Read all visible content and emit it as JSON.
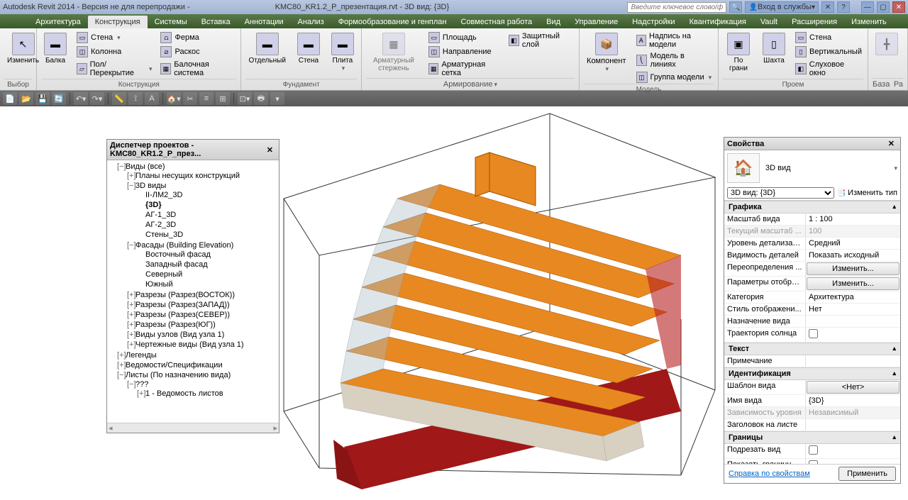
{
  "title": {
    "app": "Autodesk Revit 2014 - Версия не для перепродажи -",
    "file": "   KMC80_KR1.2_P_презентация.rvt - 3D вид: {3D}",
    "searchPlaceholder": "Введите ключевое слово/фразу",
    "loginLabel": "Вход в службы"
  },
  "tabs": [
    "Архитектура",
    "Конструкция",
    "Системы",
    "Вставка",
    "Аннотации",
    "Анализ",
    "Формообразование и генплан",
    "Совместная работа",
    "Вид",
    "Управление",
    "Надстройки",
    "Квантификация",
    "Vault",
    "Расширения",
    "Изменить"
  ],
  "activeTab": 1,
  "ribbon": {
    "select": {
      "big": "Изменить",
      "label": "Выбор"
    },
    "construct": {
      "big": "Балка",
      "small": [
        {
          "icon": "▭",
          "label": "Стена",
          "dd": true
        },
        {
          "icon": "◫",
          "label": "Колонна"
        },
        {
          "icon": "▱",
          "label": "Пол/Перекрытие",
          "dd": true
        },
        {
          "icon": "⩍",
          "label": "Ферма"
        },
        {
          "icon": "⧄",
          "label": "Раскос"
        },
        {
          "icon": "▦",
          "label": "Балочная система"
        }
      ],
      "label": "Конструкция"
    },
    "foundation": {
      "items": [
        "Отдельный",
        "Стена",
        "Плита"
      ],
      "label": "Фундамент"
    },
    "reinforce": {
      "big": "Арматурный стержень",
      "small": [
        {
          "icon": "▭",
          "label": "Площадь"
        },
        {
          "icon": "◫",
          "label": "Направление"
        },
        {
          "icon": "▦",
          "label": "Арматурная сетка"
        },
        {
          "icon": "◧",
          "label": "Защитный слой"
        }
      ],
      "label": "Армирование"
    },
    "model": {
      "big": "Компонент",
      "small": [
        {
          "icon": "A",
          "label": "Надпись на модели"
        },
        {
          "icon": "⎝",
          "label": "Модель в линиях"
        },
        {
          "icon": "◫",
          "label": "Группа модели",
          "dd": true
        }
      ],
      "label": "Модель"
    },
    "opening": {
      "big1": "По грани",
      "big2": "Шахта",
      "small": [
        {
          "icon": "▭",
          "label": "Стена"
        },
        {
          "icon": "▯",
          "label": "Вертикальный"
        },
        {
          "icon": "◧",
          "label": "Слуховое окно"
        }
      ],
      "label": "Проем"
    },
    "base": {
      "label": "База",
      "label2": "Ра"
    }
  },
  "browser": {
    "title": "Диспетчер проектов - KMC80_KR1.2_P_през...",
    "tree": [
      {
        "e": "−",
        "t": "Виды (все)",
        "c": [
          {
            "e": "+",
            "t": "Планы несущих конструкций"
          },
          {
            "e": "−",
            "t": "3D виды",
            "c": [
              {
                "t": "II-ЛМ2_3D"
              },
              {
                "t": "{3D}",
                "bold": true
              },
              {
                "t": "АГ-1_3D"
              },
              {
                "t": "АГ-2_3D"
              },
              {
                "t": "Стены_3D"
              }
            ]
          },
          {
            "e": "−",
            "t": "Фасады (Building Elevation)",
            "c": [
              {
                "t": "Восточный фасад"
              },
              {
                "t": "Западный фасад"
              },
              {
                "t": "Северный"
              },
              {
                "t": "Южный"
              }
            ]
          },
          {
            "e": "+",
            "t": "Разрезы (Разрез(ВОСТОК))"
          },
          {
            "e": "+",
            "t": "Разрезы (Разрез(ЗАПАД))"
          },
          {
            "e": "+",
            "t": "Разрезы (Разрез(СЕВЕР))"
          },
          {
            "e": "+",
            "t": "Разрезы (Разрез(ЮГ))"
          },
          {
            "e": "+",
            "t": "Виды узлов (Вид узла 1)"
          },
          {
            "e": "+",
            "t": "Чертежные виды (Вид узла 1)"
          }
        ]
      },
      {
        "e": "+",
        "t": "Легенды"
      },
      {
        "e": "+",
        "t": "Ведомости/Спецификации"
      },
      {
        "e": "−",
        "t": "Листы (По назначению вида)",
        "c": [
          {
            "e": "−",
            "t": "???",
            "c": [
              {
                "e": "+",
                "t": "1 - Ведомость листов"
              }
            ]
          }
        ]
      }
    ]
  },
  "props": {
    "title": "Свойства",
    "type": "3D вид",
    "selector": "3D вид: {3D}",
    "editType": "Изменить тип",
    "groups": [
      {
        "name": "Графика",
        "rows": [
          {
            "k": "Масштаб вида",
            "v": "1 : 100"
          },
          {
            "k": "Текущий масштаб ...",
            "v": "100",
            "disabled": true
          },
          {
            "k": "Уровень детализаци...",
            "v": "Средний"
          },
          {
            "k": "Видимость деталей",
            "v": "Показать исходный"
          },
          {
            "k": "Переопределения ...",
            "v": "Изменить...",
            "btn": true
          },
          {
            "k": "Параметры отобра...",
            "v": "Изменить...",
            "btn": true
          },
          {
            "k": "Категория",
            "v": "Архитектура"
          },
          {
            "k": "Стиль отображени...",
            "v": "Нет"
          },
          {
            "k": "Назначение вида",
            "v": ""
          },
          {
            "k": "Траектория солнца",
            "v": "",
            "check": true
          }
        ]
      },
      {
        "name": "Текст",
        "rows": [
          {
            "k": "Примечание",
            "v": ""
          }
        ]
      },
      {
        "name": "Идентификация",
        "rows": [
          {
            "k": "Шаблон вида",
            "v": "<Нет>",
            "btn": true
          },
          {
            "k": "Имя вида",
            "v": "{3D}"
          },
          {
            "k": "Зависимость уровня",
            "v": "Независимый",
            "disabled": true
          },
          {
            "k": "Заголовок на листе",
            "v": ""
          }
        ]
      },
      {
        "name": "Границы",
        "rows": [
          {
            "k": "Подрезать вид",
            "v": "",
            "check": true
          },
          {
            "k": "Показать границу ...",
            "v": "",
            "check": true
          }
        ]
      }
    ],
    "helpLink": "Справка по свойствам",
    "apply": "Применить"
  }
}
